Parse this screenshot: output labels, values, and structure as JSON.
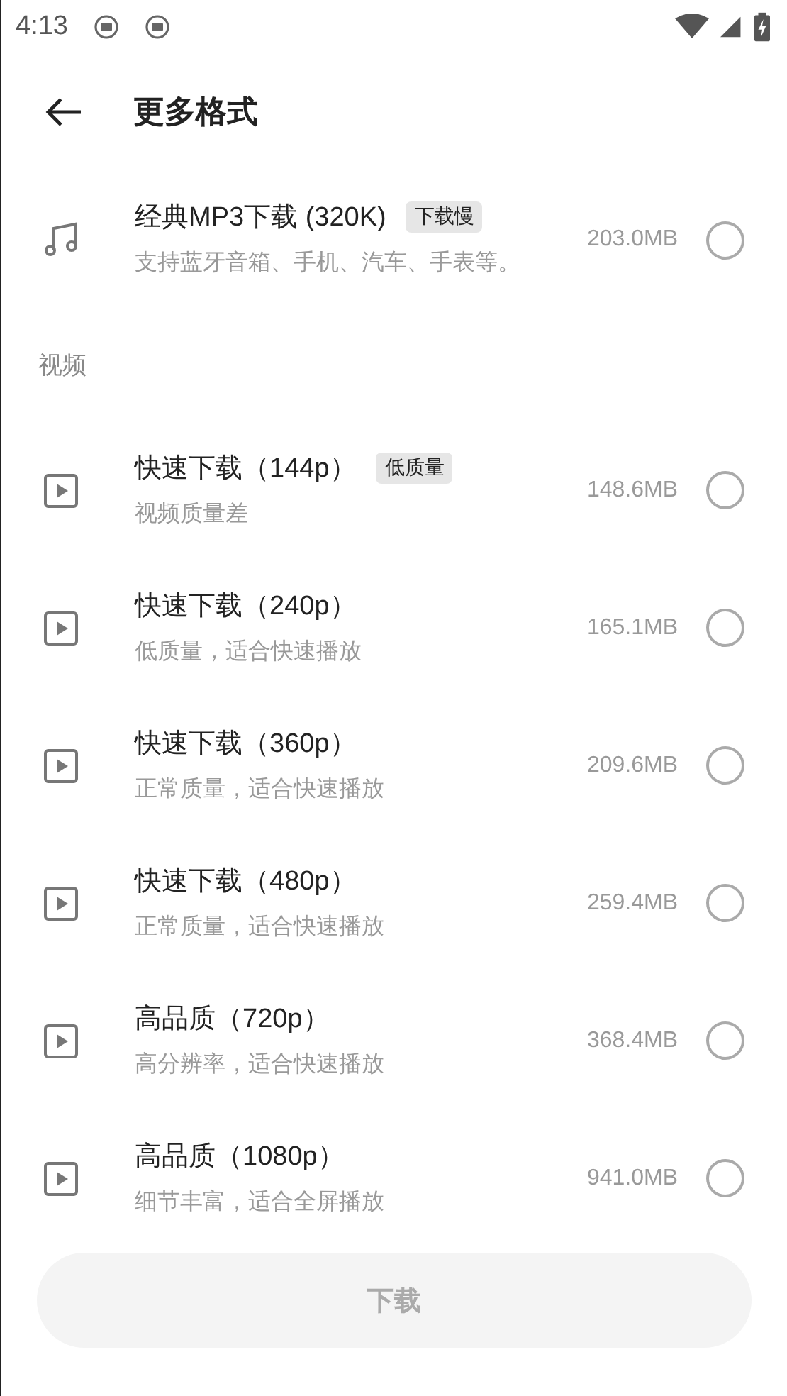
{
  "status_bar": {
    "time": "4:13"
  },
  "header": {
    "title": "更多格式"
  },
  "audio_formats": [
    {
      "kind": "audio",
      "title": "经典MP3下载 (320K)",
      "badge": "下载慢",
      "description": "支持蓝牙音箱、手机、汽车、手表等。",
      "size": "203.0MB",
      "selected": false
    }
  ],
  "video_section": {
    "label": "视频"
  },
  "video_formats": [
    {
      "kind": "video",
      "title": "快速下载（144p）",
      "badge": "低质量",
      "description": "视频质量差",
      "size": "148.6MB",
      "selected": false
    },
    {
      "kind": "video",
      "title": "快速下载（240p）",
      "description": "低质量，适合快速播放",
      "size": "165.1MB",
      "selected": false
    },
    {
      "kind": "video",
      "title": "快速下载（360p）",
      "description": "正常质量，适合快速播放",
      "size": "209.6MB",
      "selected": false
    },
    {
      "kind": "video",
      "title": "快速下载（480p）",
      "description": "正常质量，适合快速播放",
      "size": "259.4MB",
      "selected": false
    },
    {
      "kind": "video",
      "title": "高品质（720p）",
      "description": "高分辨率，适合快速播放",
      "size": "368.4MB",
      "selected": false
    },
    {
      "kind": "video",
      "title": "高品质（1080p）",
      "description": "细节丰富，适合全屏播放",
      "size": "941.0MB",
      "selected": false
    }
  ],
  "download_button": {
    "label": "下载",
    "disabled": true
  }
}
